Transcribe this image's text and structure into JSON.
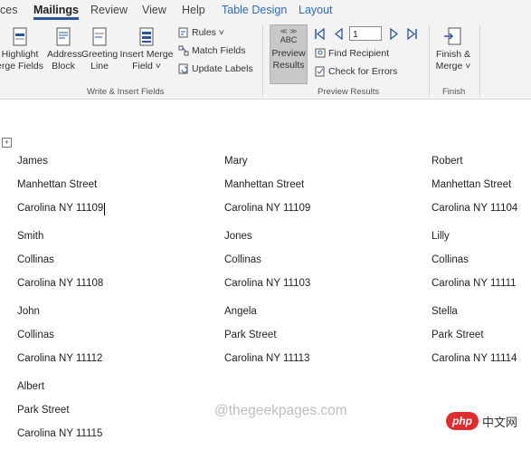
{
  "tabs": [
    {
      "label": "ces"
    },
    {
      "label": "Mailings"
    },
    {
      "label": "Review"
    },
    {
      "label": "View"
    },
    {
      "label": "Help"
    },
    {
      "label": "Table Design"
    },
    {
      "label": "Layout"
    }
  ],
  "ribbon": {
    "highlight": {
      "line1": "Highlight",
      "line2": "erge Fields"
    },
    "address": {
      "line1": "Address",
      "line2": "Block"
    },
    "greeting": {
      "line1": "Greeting",
      "line2": "Line"
    },
    "insert_merge": {
      "line1": "Insert Merge",
      "line2": "Field ˅"
    },
    "rules": "Rules ˅",
    "match_fields": "Match Fields",
    "update_labels": "Update Labels",
    "group_write": "Write & Insert Fields",
    "preview_icon": "ABC",
    "preview": {
      "line1": "Preview",
      "line2": "Results"
    },
    "record_value": "1",
    "find_recipient": "Find Recipient",
    "check_errors": "Check for Errors",
    "group_preview": "Preview Results",
    "finish": {
      "line1": "Finish &",
      "line2": "Merge ˅"
    },
    "group_finish": "Finish"
  },
  "labels": [
    {
      "name": "James",
      "street": "Manhettan Street",
      "city": "Carolina NY 11109"
    },
    {
      "name": "Mary",
      "street": "Manhettan Street",
      "city": "Carolina NY 11109"
    },
    {
      "name": "Robert",
      "street": "Manhettan Street",
      "city": "Carolina NY 11104"
    },
    {
      "name": "Smith",
      "street": "Collinas",
      "city": "Carolina NY 11108"
    },
    {
      "name": "Jones",
      "street": "Collinas",
      "city": "Carolina NY 11103"
    },
    {
      "name": "Lilly",
      "street": "Collinas",
      "city": "Carolina NY 11111"
    },
    {
      "name": "John",
      "street": "Collinas",
      "city": "Carolina NY 11112"
    },
    {
      "name": "Angela",
      "street": "Park Street",
      "city": "Carolina NY 11113"
    },
    {
      "name": "Stella",
      "street": "Park Street",
      "city": "Carolina NY 11114"
    },
    {
      "name": "Albert",
      "street": "Park Street",
      "city": "Carolina NY 11115"
    }
  ],
  "watermark": "@thegeekpages.com",
  "badge": {
    "php": "php",
    "site": "中文网"
  },
  "colors": {
    "accent": "#2b579a",
    "context_tab": "#2f6ab5",
    "ribbon_bg": "#f3f3f3"
  }
}
